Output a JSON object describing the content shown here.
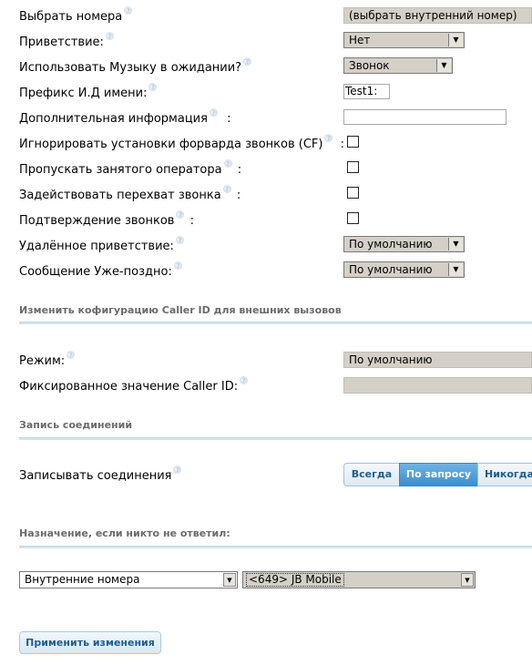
{
  "fields": {
    "select_numbers": {
      "label": "Выбрать номера",
      "value": "(выбрать внутренний номер)"
    },
    "greeting": {
      "label": "Приветствие:",
      "value": "Нет"
    },
    "music_on_hold": {
      "label": "Использовать Музыку в ожидании?",
      "value": "Звонок"
    },
    "cid_prefix": {
      "label": "Префикс И.Д имени:",
      "value": "Test1:"
    },
    "additional_info": {
      "label": "Дополнительная информация",
      "colon": ":",
      "value": ""
    },
    "ignore_cf": {
      "label": "Игнорировать установки форварда звонков (CF)",
      "colon": ":"
    },
    "skip_busy_agent": {
      "label": "Пропускать занятого оператора",
      "colon": ":"
    },
    "call_pickup": {
      "label": "Задействовать перехват звонка",
      "colon": ":"
    },
    "call_confirm": {
      "label": "Подтверждение звонков",
      "colon": ":"
    },
    "remote_greeting": {
      "label": "Удалённое приветствие:",
      "value": "По умолчанию"
    },
    "too_late_msg": {
      "label": "Сообщение Уже-поздно:",
      "value": "По умолчанию"
    }
  },
  "callerid_section": {
    "title": "Изменить кофигурацию Caller ID для внешних вызовов",
    "mode_label": "Режим:",
    "mode_value": "По умолчанию",
    "fixed_label": "Фиксированное значение Caller ID:",
    "fixed_value": ""
  },
  "recording_section": {
    "title": "Запись соединений",
    "record_label": "Записывать соединения",
    "options": [
      "Всегда",
      "По запросу",
      "Никогда"
    ],
    "selected": "По запросу"
  },
  "destination_section": {
    "title": "Назначение, если никто не ответил:",
    "type_value": "Внутренние номера",
    "target_value": "<649> JB Mobile"
  },
  "apply_button": "Применить изменения",
  "help_glyph": "?",
  "arrow_glyph": "▼",
  "colors": {
    "accent": "#3c8fd0",
    "section_line": "#cfe3f3",
    "control_gray": "#d4d0c8"
  }
}
